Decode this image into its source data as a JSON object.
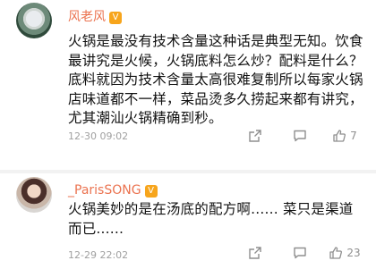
{
  "comments": [
    {
      "username": "风老风",
      "badge": "V",
      "text": "火锅是最没有技术含量这种话是典型无知。饮食最讲究是火候，火锅底料怎么炒？配料是什么？底料就因为技术含量太高很难复制所以每家火锅店味道都不一样，菜品烫多久捞起来都有讲究，尤其潮汕火锅精确到秒。",
      "time": "12-30 09:02",
      "likes": "7"
    },
    {
      "username": "_ParisSONG",
      "badge": "V",
      "text": "火锅美妙的是在汤底的配方啊...... 菜只是渠道而已......",
      "time": "12-29 22:02",
      "likes": "23"
    }
  ],
  "icons": {
    "share": "share-icon",
    "comment": "comment-icon",
    "like": "thumbs-up-icon"
  },
  "colors": {
    "username": "#eb7350",
    "badge": "#f7a51c",
    "icon": "#8f8f8f"
  }
}
